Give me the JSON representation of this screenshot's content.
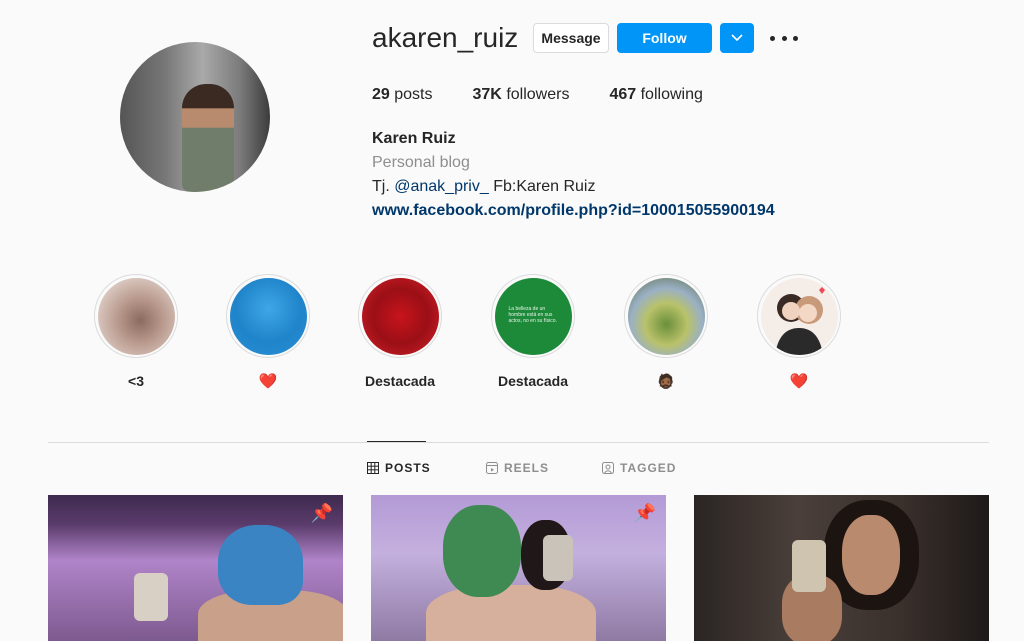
{
  "profile": {
    "username": "akaren_ruiz",
    "message_label": "Message",
    "follow_label": "Follow",
    "dropdown_icon": "chevron-down-icon",
    "more_icon": "more-options-icon",
    "stats": {
      "posts_count": "29",
      "posts_label": "posts",
      "followers_count": "37K",
      "followers_label": "followers",
      "following_count": "467",
      "following_label": "following"
    },
    "full_name": "Karen Ruiz",
    "category": "Personal blog",
    "bio_prefix": "Tj.",
    "bio_mention": "@anak_priv_",
    "bio_suffix": "Fb:Karen Ruiz",
    "website": "www.facebook.com/profile.php?id=100015055900194"
  },
  "highlights": [
    {
      "label": "<3"
    },
    {
      "label": "❤️"
    },
    {
      "label": "Destacada"
    },
    {
      "label": "Destacada",
      "thumb_text": "La belleza de un hombre está en sus actos, no en su físico."
    },
    {
      "label": "🧔🏾"
    },
    {
      "label": "❤️"
    }
  ],
  "tabs": [
    {
      "label": "POSTS",
      "icon": "grid-icon",
      "active": true
    },
    {
      "label": "REELS",
      "icon": "reels-icon",
      "active": false
    },
    {
      "label": "TAGGED",
      "icon": "tagged-icon",
      "active": false
    }
  ],
  "posts": [
    {
      "pinned": true
    },
    {
      "pinned": true
    },
    {
      "pinned": false
    }
  ],
  "colors": {
    "accent": "#0095f6",
    "link": "#00376b",
    "muted": "#8e8e8e",
    "heart": "#ed4956"
  }
}
